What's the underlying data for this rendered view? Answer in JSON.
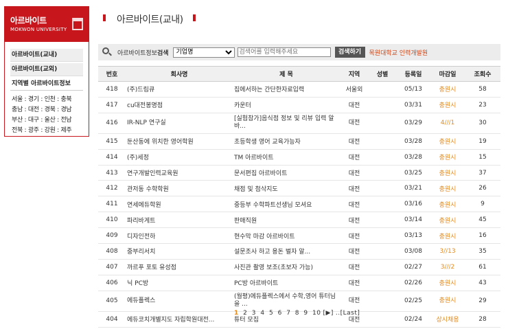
{
  "sidebar": {
    "header_title": "아르바이트",
    "header_subtitle": "MOKWON UNIVERSITY",
    "menu": [
      "아르바이트(교내)",
      "아르바이트(교외)",
      "지역별 아르바이트정보"
    ],
    "regions": [
      "서울 : 경기 : 인천 : 충북",
      "충남 : 대전 : 경북 : 경남",
      "부산 : 대구 : 울산 : 전남",
      "전북 : 광주 : 강원 : 제주"
    ]
  },
  "page_title": "아르바이트(교내)",
  "search": {
    "label_prefix": "아르바이트정보",
    "label_bold": "검색",
    "select_value": "기업명",
    "placeholder": "검색어를 입력해주세요",
    "button": "검색하기",
    "link": "목원대학교 인력개발원"
  },
  "table": {
    "headers": [
      "번호",
      "회사명",
      "제 목",
      "지역",
      "성별",
      "등록일",
      "마감일",
      "조회수"
    ],
    "rows": [
      {
        "no": "418",
        "company": "(주)드림큐",
        "title": "집에서하는 간단한자료입력",
        "region": "서울외",
        "gender": "",
        "date": "05/13",
        "deadline": "충원시",
        "views": "58"
      },
      {
        "no": "417",
        "company": "cu대전봉명점",
        "title": "카운터",
        "region": "대전",
        "gender": "",
        "date": "03/31",
        "deadline": "충원시",
        "views": "23"
      },
      {
        "no": "416",
        "company": "IR-NLP 연구실",
        "title": "[실험참가]음식점 정보 및 리뷰 입력 알바...",
        "region": "대전",
        "gender": "",
        "date": "03/29",
        "deadline": "4///1",
        "views": "30"
      },
      {
        "no": "415",
        "company": "둔산동에 위치한 영어학원",
        "title": "초등학생 영어 교육가능자",
        "region": "대전",
        "gender": "",
        "date": "03/28",
        "deadline": "충원시",
        "views": "19"
      },
      {
        "no": "414",
        "company": "(주)세정",
        "title": "TM 아르바이트",
        "region": "대전",
        "gender": "",
        "date": "03/28",
        "deadline": "충원시",
        "views": "15"
      },
      {
        "no": "413",
        "company": "연구개발인력교육원",
        "title": "문서편집 아르바이트",
        "region": "대전",
        "gender": "",
        "date": "03/25",
        "deadline": "충원시",
        "views": "37"
      },
      {
        "no": "412",
        "company": "관저동 수학학원",
        "title": "채점 및 첨삭지도",
        "region": "대전",
        "gender": "",
        "date": "03/21",
        "deadline": "충원시",
        "views": "26"
      },
      {
        "no": "411",
        "company": "연세에듀학원",
        "title": "중등부 수학파트선생님 모셔요",
        "region": "대전",
        "gender": "",
        "date": "03/16",
        "deadline": "충원시",
        "views": "9"
      },
      {
        "no": "410",
        "company": "파리바게트",
        "title": "판매직원",
        "region": "대전",
        "gender": "",
        "date": "03/14",
        "deadline": "충원시",
        "views": "45"
      },
      {
        "no": "409",
        "company": "디자인전하",
        "title": "현수막 마감 아르바이트",
        "region": "대전",
        "gender": "",
        "date": "03/13",
        "deadline": "충원시",
        "views": "16"
      },
      {
        "no": "408",
        "company": "중부리서치",
        "title": "설문조사 하고 용돈 벌자 알...",
        "region": "대전",
        "gender": "",
        "date": "03/08",
        "deadline": "3//13",
        "views": "35"
      },
      {
        "no": "407",
        "company": "까르푸 포토 유성점",
        "title": "사진관 촬영 보조(초보자 가능)",
        "region": "대전",
        "gender": "",
        "date": "02/27",
        "deadline": "3///2",
        "views": "61"
      },
      {
        "no": "406",
        "company": "닉 PC방",
        "title": "PC방 아르바이트",
        "region": "대전",
        "gender": "",
        "date": "02/26",
        "deadline": "충원시",
        "views": "43"
      },
      {
        "no": "405",
        "company": "에듀플렉스",
        "title": "(월평)에듀플렉스에서 수학,영어 튜터님을 ...",
        "region": "대전",
        "gender": "",
        "date": "02/25",
        "deadline": "충원시",
        "views": "29"
      },
      {
        "no": "404",
        "company": "에듀코치개별지도 자립학원대전...",
        "title": "튜터 모집",
        "region": "대전",
        "gender": "",
        "date": "02/24",
        "deadline": "상시채용",
        "views": "28"
      }
    ]
  },
  "pager": {
    "current": "1",
    "pages": [
      "2",
      "3",
      "4",
      "5",
      "6",
      "7",
      "8",
      "9",
      "10"
    ],
    "next": "[▶]",
    "last": "..[Last]"
  },
  "colors": {
    "brand_red": "#c8161d",
    "accent_orange": "#e48a1e"
  },
  "icons": [
    "magnifier-icon",
    "cube-logo-icon"
  ]
}
